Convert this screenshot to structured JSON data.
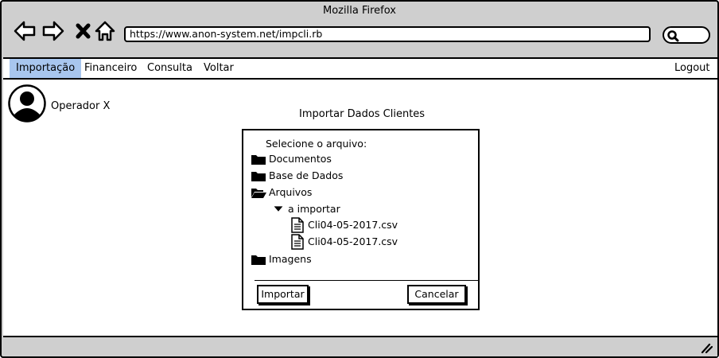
{
  "window": {
    "title": "Mozilla Firefox"
  },
  "browser": {
    "url": "https://www.anon-system.net/impcli.rb",
    "icons": [
      "back-icon",
      "forward-icon",
      "close-icon",
      "home-icon",
      "search-icon"
    ]
  },
  "menu": {
    "items": [
      {
        "label": "Importação",
        "active": true
      },
      {
        "label": "Financeiro",
        "active": false
      },
      {
        "label": "Consulta",
        "active": false
      },
      {
        "label": "Voltar",
        "active": false
      }
    ],
    "logout": "Logout"
  },
  "user": {
    "name": "Operador X",
    "icon": "avatar-icon"
  },
  "page": {
    "title": "Importar Dados Clientes"
  },
  "dialog": {
    "prompt": "Selecione o arquivo:",
    "tree": [
      {
        "label": "Documentos",
        "icon": "folder-icon",
        "level": 0
      },
      {
        "label": "Base de Dados",
        "icon": "folder-icon",
        "level": 0
      },
      {
        "label": "Arquivos",
        "icon": "folder-open-icon",
        "level": 0
      },
      {
        "label": "a importar",
        "icon": "caret-down-icon",
        "level": 1
      },
      {
        "label": "Cli04-05-2017.csv",
        "icon": "file-icon",
        "level": 2
      },
      {
        "label": "Cli04-05-2017.csv",
        "icon": "file-icon",
        "level": 2
      },
      {
        "label": "Imagens",
        "icon": "folder-icon",
        "level": 0
      }
    ],
    "import_button": "Importar",
    "cancel_button": "Cancelar"
  },
  "colors": {
    "active_menu": "#a8c6ee",
    "chrome": "#cfcfcf",
    "border": "#000000"
  }
}
